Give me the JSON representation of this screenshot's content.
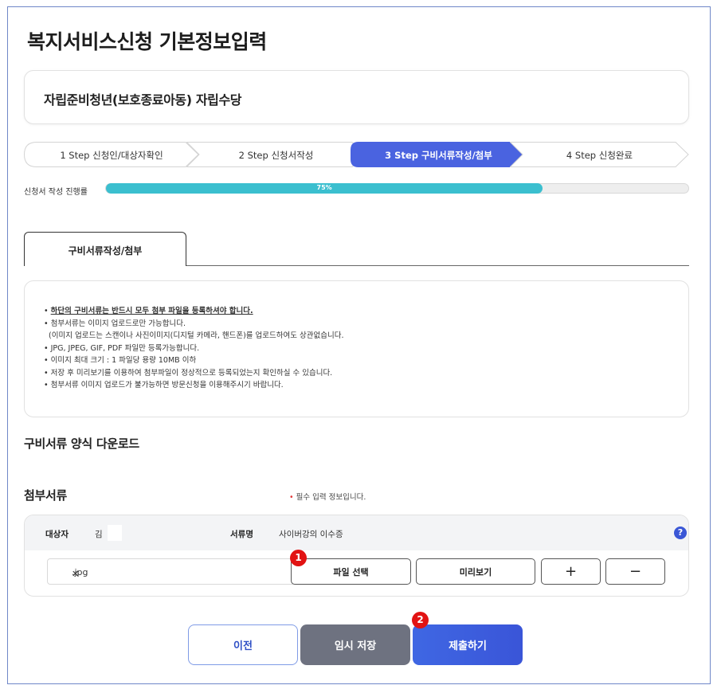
{
  "page": {
    "title": "복지서비스신청 기본정보입력"
  },
  "service": {
    "name": "자립준비청년(보호종료아동) 자립수당"
  },
  "steps": [
    {
      "label": "1 Step 신청인/대상자확인",
      "active": false
    },
    {
      "label": "2 Step 신청서작성",
      "active": false
    },
    {
      "label": "3 Step 구비서류작성/첨부",
      "active": true
    },
    {
      "label": "4 Step 신청완료",
      "active": false
    }
  ],
  "progress": {
    "label": "신청서 작성 진행률",
    "value": 75,
    "text": "75%"
  },
  "tab": {
    "label": "구비서류작성/첨부"
  },
  "notice": {
    "items": [
      "하단의 구비서류는 반드시 모두 첨부 파일을 등록하셔야 합니다.",
      "첨부서류는 이미지 업로드로만 가능합니다.",
      "(이미지 업로드는 스캔이나 사진이미지(디지털 카메라, 핸드폰)를 업로드하여도 상관없습니다.",
      "JPG, JPEG, GIF, PDF 파일만 등록가능합니다.",
      "이미지 최대 크기 : 1 파일당 용량 10MB 이하",
      "저장 후 미리보기를 이용하여 첨부파일이 정상적으로 등록되었는지 확인하실 수 있습니다.",
      "첨부서류 이미지 업로드가 불가능하면 방문신청을 이용해주시기 바랍니다."
    ]
  },
  "download": {
    "title": "구비서류 양식 다운로드"
  },
  "attach": {
    "title": "첨부서류",
    "required_note": "필수 입력 정보입니다.",
    "subject_label": "대상자",
    "subject_value": "김",
    "docname_label": "서류명",
    "docname_value": "사이버강의 이수증",
    "help_glyph": "?",
    "file_value": ".jpg",
    "clear_glyph": "✕",
    "select_label": "파일 선택",
    "preview_label": "미리보기",
    "add_glyph": "+",
    "remove_glyph": "−"
  },
  "badges": {
    "first": "1",
    "second": "2"
  },
  "buttons": {
    "prev": "이전",
    "temp_save": "임시 저장",
    "submit": "제출하기"
  },
  "colors": {
    "accent": "#4a63e0",
    "progress": "#3bbfcf",
    "badge": "#e21313",
    "temp": "#6e7280"
  }
}
